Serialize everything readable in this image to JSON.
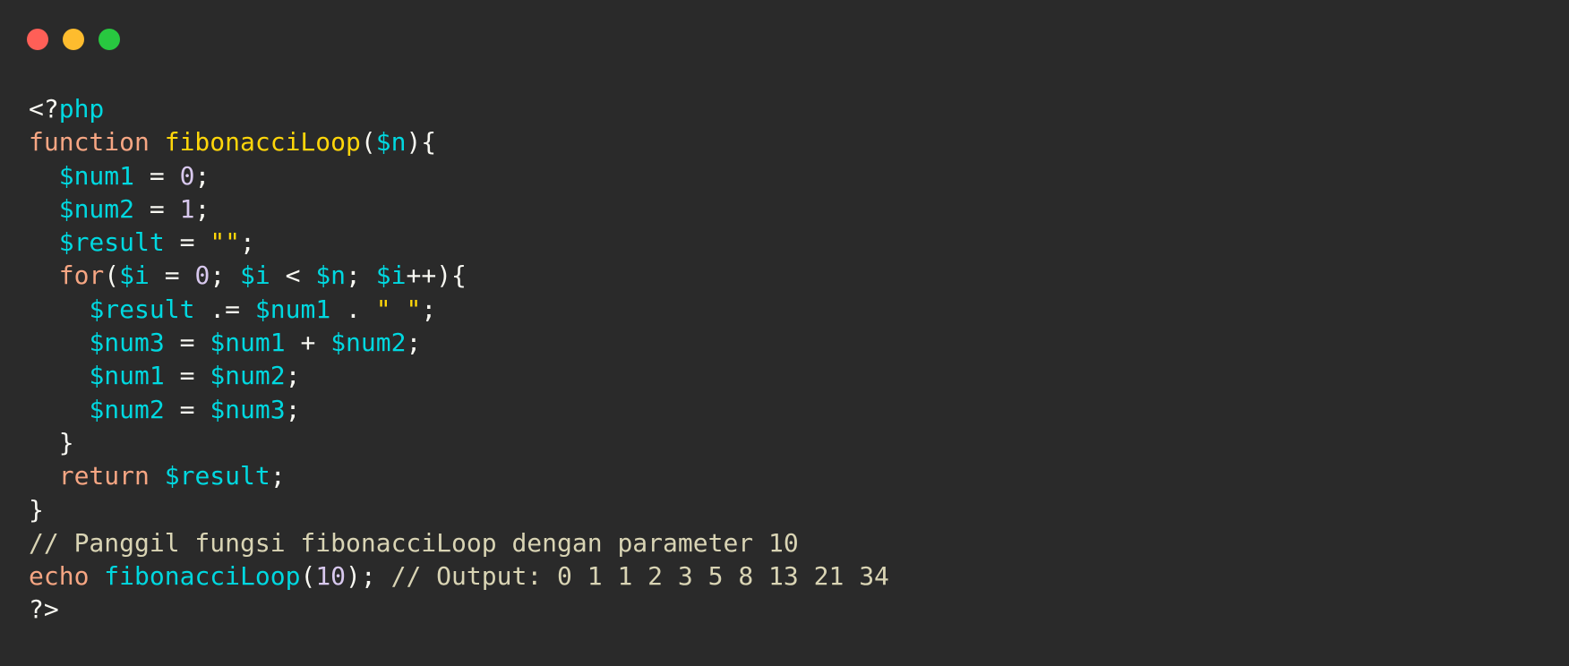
{
  "window": {
    "traffic_lights": [
      "close",
      "minimize",
      "maximize"
    ]
  },
  "colors": {
    "background": "#2a2a2a",
    "keyword": "#f6a683",
    "function_name": "#ffd60a",
    "variable": "#00d8e0",
    "number": "#d8c8ee",
    "string": "#ffd60a",
    "comment": "#d9d4b4",
    "plain": "#f8f8f2"
  },
  "code": {
    "lines": [
      [
        {
          "t": "<?",
          "c": "op"
        },
        {
          "t": "php",
          "c": "var"
        }
      ],
      [
        {
          "t": "function",
          "c": "kw"
        },
        {
          "t": " ",
          "c": "op"
        },
        {
          "t": "fibonacciLoop",
          "c": "fn"
        },
        {
          "t": "(",
          "c": "op"
        },
        {
          "t": "$n",
          "c": "var"
        },
        {
          "t": "){",
          "c": "op"
        }
      ],
      [
        {
          "t": "  ",
          "c": "op"
        },
        {
          "t": "$num1",
          "c": "var"
        },
        {
          "t": " = ",
          "c": "op"
        },
        {
          "t": "0",
          "c": "num"
        },
        {
          "t": ";",
          "c": "op"
        }
      ],
      [
        {
          "t": "  ",
          "c": "op"
        },
        {
          "t": "$num2",
          "c": "var"
        },
        {
          "t": " = ",
          "c": "op"
        },
        {
          "t": "1",
          "c": "num"
        },
        {
          "t": ";",
          "c": "op"
        }
      ],
      [
        {
          "t": "  ",
          "c": "op"
        },
        {
          "t": "$result",
          "c": "var"
        },
        {
          "t": " = ",
          "c": "op"
        },
        {
          "t": "\"\"",
          "c": "str"
        },
        {
          "t": ";",
          "c": "op"
        }
      ],
      [
        {
          "t": "  ",
          "c": "op"
        },
        {
          "t": "for",
          "c": "kw"
        },
        {
          "t": "(",
          "c": "op"
        },
        {
          "t": "$i",
          "c": "var"
        },
        {
          "t": " = ",
          "c": "op"
        },
        {
          "t": "0",
          "c": "num"
        },
        {
          "t": "; ",
          "c": "op"
        },
        {
          "t": "$i",
          "c": "var"
        },
        {
          "t": " < ",
          "c": "op"
        },
        {
          "t": "$n",
          "c": "var"
        },
        {
          "t": "; ",
          "c": "op"
        },
        {
          "t": "$i",
          "c": "var"
        },
        {
          "t": "++){",
          "c": "op"
        }
      ],
      [
        {
          "t": "    ",
          "c": "op"
        },
        {
          "t": "$result",
          "c": "var"
        },
        {
          "t": " .= ",
          "c": "op"
        },
        {
          "t": "$num1",
          "c": "var"
        },
        {
          "t": " . ",
          "c": "op"
        },
        {
          "t": "\" \"",
          "c": "str"
        },
        {
          "t": ";",
          "c": "op"
        }
      ],
      [
        {
          "t": "    ",
          "c": "op"
        },
        {
          "t": "$num3",
          "c": "var"
        },
        {
          "t": " = ",
          "c": "op"
        },
        {
          "t": "$num1",
          "c": "var"
        },
        {
          "t": " + ",
          "c": "op"
        },
        {
          "t": "$num2",
          "c": "var"
        },
        {
          "t": ";",
          "c": "op"
        }
      ],
      [
        {
          "t": "    ",
          "c": "op"
        },
        {
          "t": "$num1",
          "c": "var"
        },
        {
          "t": " = ",
          "c": "op"
        },
        {
          "t": "$num2",
          "c": "var"
        },
        {
          "t": ";",
          "c": "op"
        }
      ],
      [
        {
          "t": "    ",
          "c": "op"
        },
        {
          "t": "$num2",
          "c": "var"
        },
        {
          "t": " = ",
          "c": "op"
        },
        {
          "t": "$num3",
          "c": "var"
        },
        {
          "t": ";",
          "c": "op"
        }
      ],
      [
        {
          "t": "  }",
          "c": "op"
        }
      ],
      [
        {
          "t": "  ",
          "c": "op"
        },
        {
          "t": "return",
          "c": "kw"
        },
        {
          "t": " ",
          "c": "op"
        },
        {
          "t": "$result",
          "c": "var"
        },
        {
          "t": ";",
          "c": "op"
        }
      ],
      [
        {
          "t": "}",
          "c": "op"
        }
      ],
      [
        {
          "t": "// Panggil fungsi fibonacciLoop dengan parameter 10",
          "c": "com"
        }
      ],
      [
        {
          "t": "echo",
          "c": "kw"
        },
        {
          "t": " ",
          "c": "op"
        },
        {
          "t": "fibonacciLoop",
          "c": "var"
        },
        {
          "t": "(",
          "c": "op"
        },
        {
          "t": "10",
          "c": "num"
        },
        {
          "t": "); ",
          "c": "op"
        },
        {
          "t": "// Output: 0 1 1 2 3 5 8 13 21 34",
          "c": "com"
        }
      ],
      [
        {
          "t": "?>",
          "c": "op"
        }
      ]
    ]
  }
}
